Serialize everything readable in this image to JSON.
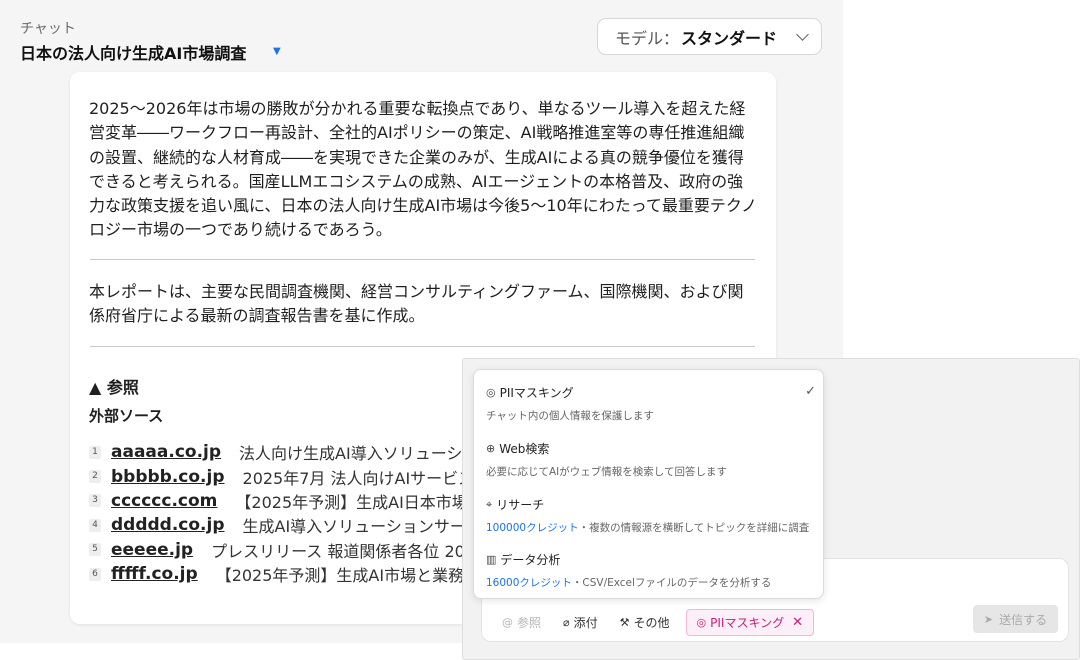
{
  "header": {
    "subtitle": "チャット",
    "title": "日本の法人向け生成AI市場調査",
    "title_caret": "▼"
  },
  "model": {
    "label": "モデル：",
    "value": "スタンダード"
  },
  "report": {
    "conclusion": "2025〜2026年は市場の勝敗が分かれる重要な転換点であり、単なるツール導入を超えた経営変革――ワークフロー再設計、全社的AIポリシーの策定、AI戦略推進室等の専任推進組織の設置、継続的な人材育成――を実現できた企業のみが、生成AIによる真の競争優位を獲得できると考えられる。国産LLMエコシステムの成熟、AIエージェントの本格普及、政府の強力な政策支援を追い風に、日本の法人向け生成AI市場は今後5〜10年にわたって最重要テクノロジー市場の一つであり続けるであろう。",
    "note": "本レポートは、主要な民間調査機関、経営コンサルティングファーム、国際機関、および関係府省庁による最新の調査報告書を基に作成。",
    "references_toggle": "▲ 参照",
    "external_sources_heading": "外部ソース",
    "sources": [
      {
        "num": "1",
        "domain": "aaaaa.co.jp",
        "title": "法人向け生成AI導入ソリューシ"
      },
      {
        "num": "2",
        "domain": "bbbbb.co.jp",
        "title": "2025年7月 法人向けAIサービス"
      },
      {
        "num": "3",
        "domain": "cccccc.com",
        "title": "【2025年予測】生成AI日本市場"
      },
      {
        "num": "4",
        "domain": "ddddd.co.jp",
        "title": "生成AI導入ソリューションサー"
      },
      {
        "num": "5",
        "domain": "eeeee.jp",
        "title": "プレスリリース 報道関係者各位 20"
      },
      {
        "num": "6",
        "domain": "fffff.co.jp",
        "title": "【2025年予測】生成AI市場と業務"
      }
    ]
  },
  "options_menu": {
    "items": [
      {
        "title": "PIIマスキング",
        "credit": "",
        "desc": "チャット内の個人情報を保護します",
        "checked": "✓"
      },
      {
        "title": "Web検索",
        "credit": "",
        "desc": "必要に応じてAIがウェブ情報を検索して回答します",
        "checked": ""
      },
      {
        "title": "リサーチ",
        "credit": "100000クレジット",
        "desc": "・複数の情報源を横断してトピックを詳細に調査",
        "checked": ""
      },
      {
        "title": "データ分析",
        "credit": "16000クレジット",
        "desc": "・CSV/Excelファイルのデータを分析する",
        "checked": ""
      }
    ]
  },
  "composer": {
    "reference_label": "参照",
    "attach_label": "添付",
    "other_label": "その他",
    "pii_chip_label": "PIIマスキング",
    "send_label": "送信する"
  },
  "colors": {
    "accent": "#1a73e8",
    "pii_pink": "#c2207a"
  }
}
